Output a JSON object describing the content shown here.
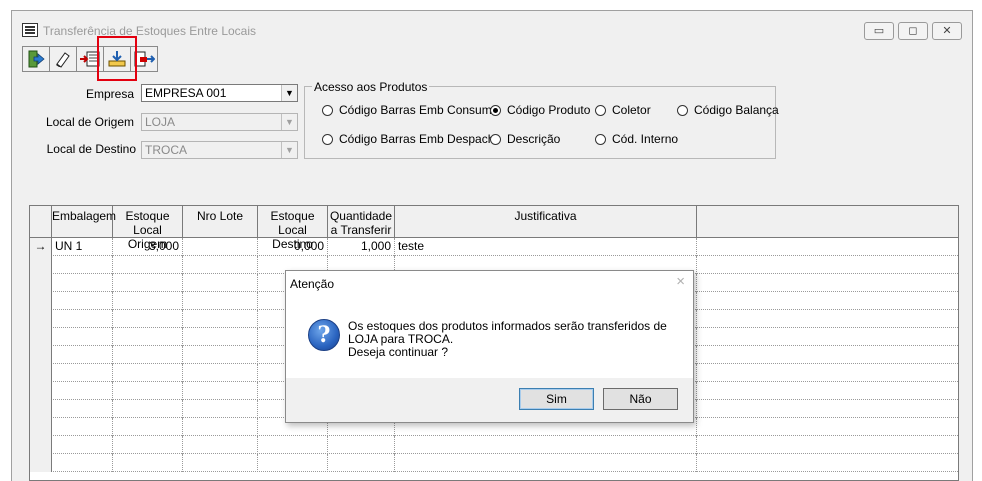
{
  "window": {
    "title": "Transferência de Estoques Entre Locais"
  },
  "toolbar": {
    "buttons": [
      {
        "icon": "exit-icon"
      },
      {
        "icon": "eraser-icon"
      },
      {
        "icon": "import-icon"
      },
      {
        "icon": "transfer-icon"
      },
      {
        "icon": "export-icon"
      }
    ]
  },
  "form": {
    "empresa_label": "Empresa",
    "empresa_value": "EMPRESA 001",
    "origem_label": "Local de Origem",
    "origem_value": "LOJA",
    "destino_label": "Local de Destino",
    "destino_value": "TROCA"
  },
  "acesso": {
    "title": "Acesso aos Produtos",
    "options": [
      "Código Barras Emb Consumo",
      "Código Produto",
      "Coletor",
      "Código Balança",
      "Código Barras Emb Despacho",
      "Descrição",
      "Cód. Interno"
    ],
    "selected": "Código Produto"
  },
  "grid": {
    "columns": [
      [
        "Embalagem",
        ""
      ],
      [
        "Estoque",
        "Local Origem"
      ],
      [
        "Nro Lote",
        ""
      ],
      [
        "Estoque",
        "Local Destino"
      ],
      [
        "Quantidade",
        "a Transferir"
      ],
      [
        "Justificativa",
        ""
      ]
    ],
    "rows": [
      {
        "embalagem": "UN  1",
        "origem": "3,000",
        "lote": "",
        "destino": "0,000",
        "quantidade": "1,000",
        "justificativa": "teste"
      }
    ],
    "row_indicator": "→"
  },
  "dialog": {
    "title": "Atenção",
    "close": "×",
    "icon": "?",
    "line1": "Os estoques dos produtos informados serão transferidos de",
    "line2": "LOJA para TROCA.",
    "line3": "Deseja continuar ?",
    "yes": "Sim",
    "no": "Não"
  }
}
